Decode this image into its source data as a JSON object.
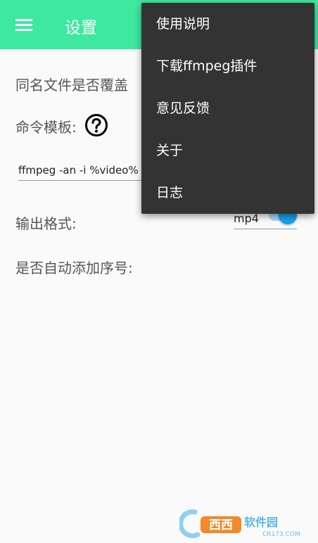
{
  "appbar": {
    "title": "设置",
    "color": "#3ee8a0"
  },
  "settings": {
    "overwrite_label": "同名文件是否覆盖",
    "template_label": "命令模板:",
    "template_value": "ffmpeg -an -i %video% -v",
    "format_label": "输出格式:",
    "format_value": "mp4",
    "auto_number_label": "是否自动添加序号:",
    "auto_number_enabled": true
  },
  "menu": {
    "items": [
      "使用说明",
      "下载ffmpeg插件",
      "意见反馈",
      "关于",
      "日志"
    ]
  },
  "watermark": {
    "brand": "西西",
    "suffix": "软件园",
    "site": "CR173.COM"
  }
}
